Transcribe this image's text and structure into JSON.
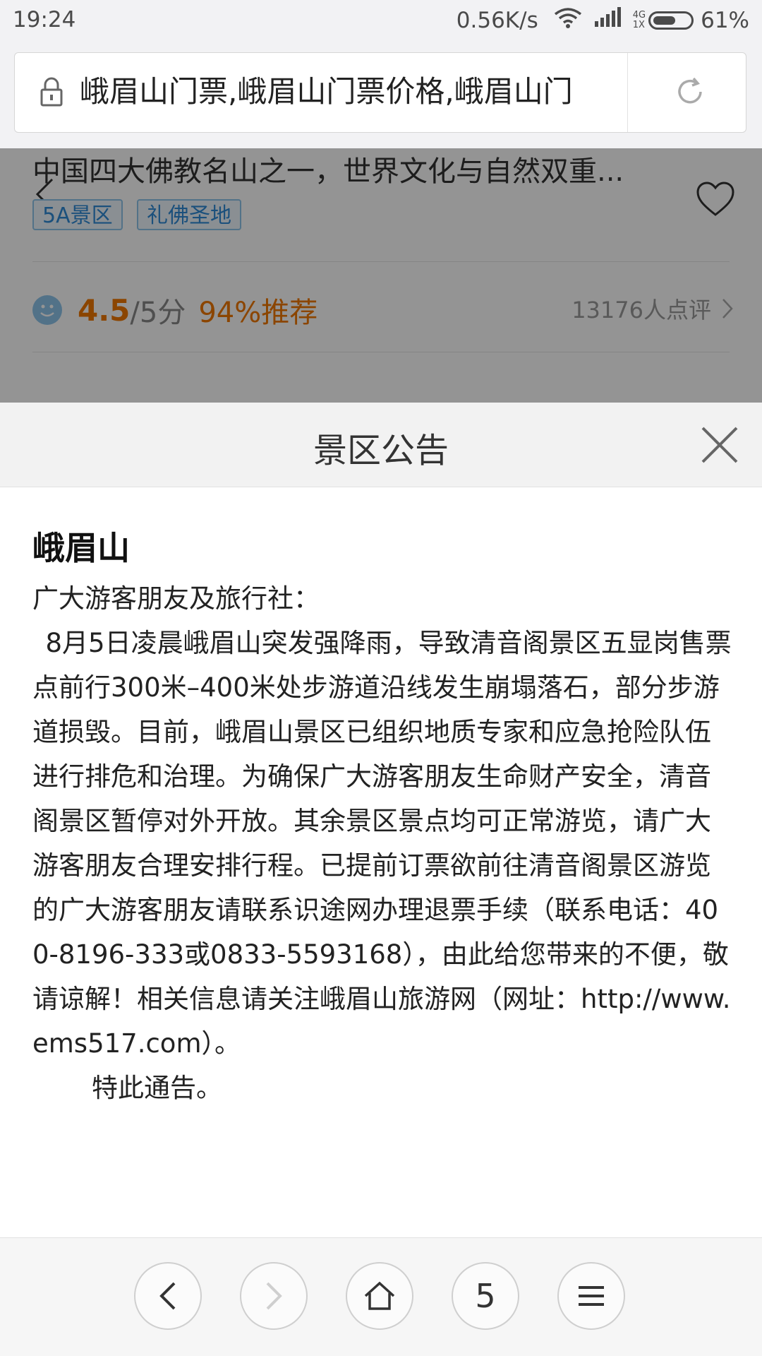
{
  "status_bar": {
    "time": "19:24",
    "net_speed": "0.56K/s",
    "net_type_top": "4G",
    "net_type_bottom": "1X",
    "battery_percent": "61%",
    "battery_level": 0.61
  },
  "browser": {
    "url_title": "峨眉山门票,峨眉山门票价格,峨眉山门",
    "icons": {
      "lock": "lock-icon",
      "refresh": "refresh-icon"
    }
  },
  "background_page": {
    "description": "中国四大佛教名山之一，世界文化与自然双重...",
    "tags": [
      "5A景区",
      "礼佛圣地"
    ],
    "rating": {
      "score": "4.5",
      "max": "/5分",
      "recommend": "94%推荐",
      "reviews": "13176人点评"
    },
    "colors": {
      "accent": "#f07800",
      "tag": "#2f8ad6"
    }
  },
  "modal": {
    "title": "景区公告",
    "spot_name": "峨眉山",
    "greeting": "广大游客朋友及旅行社：",
    "content": "8月5日凌晨峨眉山突发强降雨，导致清音阁景区五显岗售票点前行300米–400米处步游道沿线发生崩塌落石，部分步游道损毁。目前，峨眉山景区已组织地质专家和应急抢险队伍进行排危和治理。为确保广大游客朋友生命财产安全，清音阁景区暂停对外开放。其余景区景点均可正常游览，请广大游客朋友合理安排行程。已提前订票欲前往清音阁景区游览的广大游客朋友请联系识途网办理退票手续（联系电话：400-8196-333或0833-5593168），由此给您带来的不便，敬请谅解！相关信息请关注峨眉山旅游网（网址：http://www.ems517.com）。",
    "closing": "特此通告。"
  },
  "bottom_nav": {
    "tab_count": "5"
  }
}
